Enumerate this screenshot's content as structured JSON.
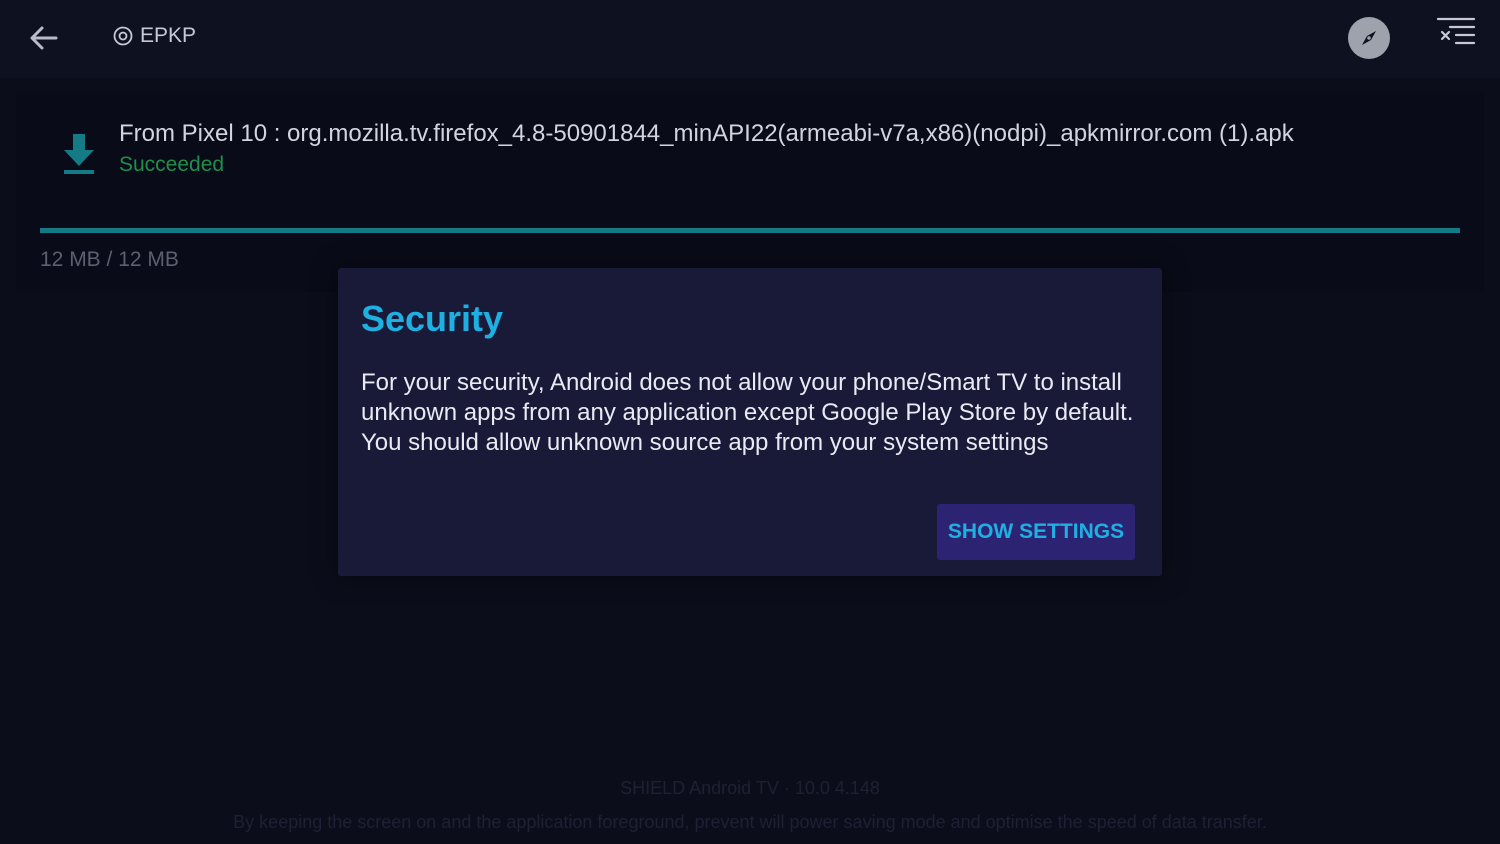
{
  "header": {
    "title": "EPKP",
    "icons": {
      "back": "arrow-left-icon",
      "app": "target-icon",
      "compass": "compass-icon",
      "menu": "clear-list-icon"
    }
  },
  "download": {
    "file_name": "From Pixel 10 : org.mozilla.tv.firefox_4.8-50901844_minAPI22(armeabi-v7a,x86)(nodpi)_apkmirror.com (1).apk",
    "status": "Succeeded",
    "size": "12 MB / 12 MB",
    "progress": 1.0
  },
  "dialog": {
    "title": "Security",
    "body_lines": [
      "For your security, Android does not allow your phone/Smart TV to install unknown apps from any application except Google Play Store by default.",
      "You should allow unknown source app from your system settings"
    ],
    "button_label": "SHOW SETTINGS"
  },
  "footer": {
    "device": "SHIELD Android TV · 10.0 4.148",
    "tip": "By keeping the screen on and the application foreground, prevent will power saving mode and optimise the speed of data transfer."
  },
  "colors": {
    "accent": "#1fb0e3",
    "success": "#1e8f4a",
    "progress": "#147a86",
    "dialog_bg": "#191a38",
    "button_bg": "#2c2472"
  }
}
